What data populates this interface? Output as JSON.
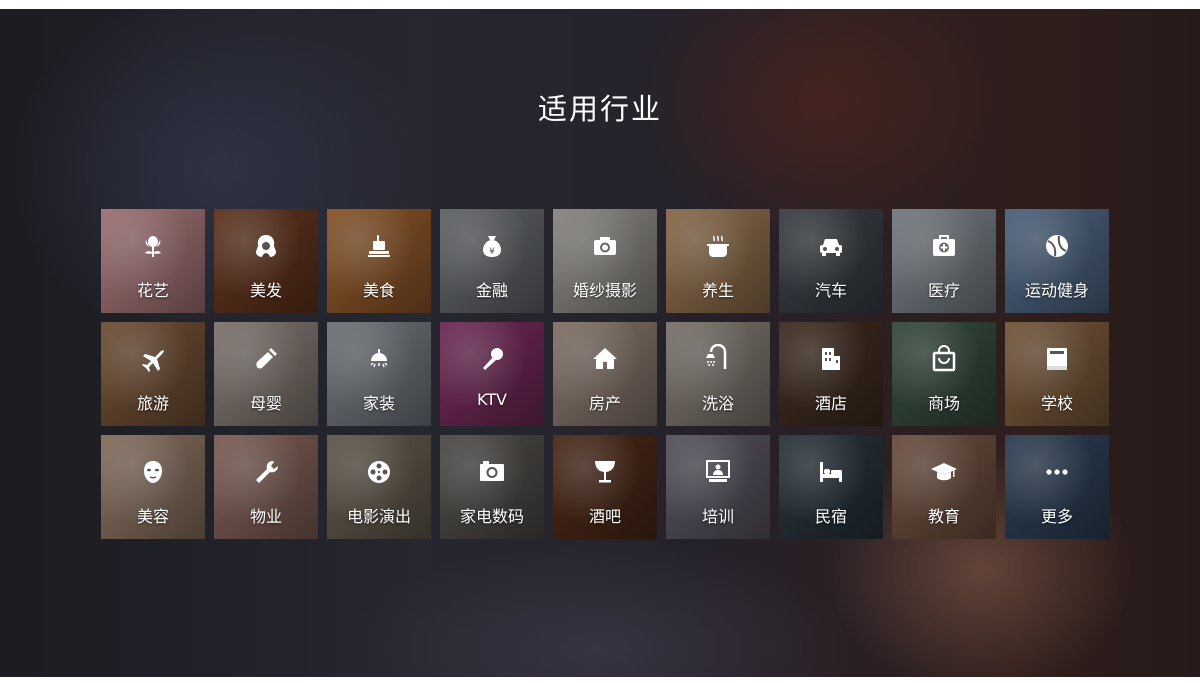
{
  "title": "适用行业",
  "industries": [
    {
      "label": "花艺",
      "icon": "flower-icon",
      "color": "#e7a4a6"
    },
    {
      "label": "美发",
      "icon": "hair-icon",
      "color": "#8a4a2b"
    },
    {
      "label": "美食",
      "icon": "food-icon",
      "color": "#c87a3a"
    },
    {
      "label": "金融",
      "icon": "money-bag-icon",
      "color": "#8a8f95"
    },
    {
      "label": "婚纱摄影",
      "icon": "camera-icon",
      "color": "#c7c2ba"
    },
    {
      "label": "养生",
      "icon": "pot-icon",
      "color": "#c89a6a"
    },
    {
      "label": "汽车",
      "icon": "car-icon",
      "color": "#525963"
    },
    {
      "label": "医疗",
      "icon": "medical-kit-icon",
      "color": "#a8b2bc"
    },
    {
      "label": "运动健身",
      "icon": "ball-icon",
      "color": "#6d8db5"
    },
    {
      "label": "旅游",
      "icon": "airplane-icon",
      "color": "#a0704a"
    },
    {
      "label": "母婴",
      "icon": "baby-bottle-icon",
      "color": "#b7a9a0"
    },
    {
      "label": "家装",
      "icon": "lamp-icon",
      "color": "#9fa7b0"
    },
    {
      "label": "KTV",
      "icon": "microphone-icon",
      "color": "#a23b7c"
    },
    {
      "label": "房产",
      "icon": "house-icon",
      "color": "#bba596"
    },
    {
      "label": "洗浴",
      "icon": "shower-icon",
      "color": "#b2a69c"
    },
    {
      "label": "酒店",
      "icon": "hotel-icon",
      "color": "#5a3f2e"
    },
    {
      "label": "商场",
      "icon": "shopping-bag-icon",
      "color": "#4b6a58"
    },
    {
      "label": "学校",
      "icon": "book-icon",
      "color": "#a97c52"
    },
    {
      "label": "美容",
      "icon": "mask-icon",
      "color": "#c2a088"
    },
    {
      "label": "物业",
      "icon": "wrench-icon",
      "color": "#b5867a"
    },
    {
      "label": "电影演出",
      "icon": "film-reel-icon",
      "color": "#8a7e6c"
    },
    {
      "label": "家电数码",
      "icon": "photo-camera-icon",
      "color": "#6f6a66"
    },
    {
      "label": "酒吧",
      "icon": "cocktail-icon",
      "color": "#6a3a22"
    },
    {
      "label": "培训",
      "icon": "presentation-icon",
      "color": "#7d7688"
    },
    {
      "label": "民宿",
      "icon": "bed-icon",
      "color": "#3a4a55"
    },
    {
      "label": "教育",
      "icon": "graduation-cap-icon",
      "color": "#9b6f58"
    },
    {
      "label": "更多",
      "icon": "more-icon",
      "color": "#3f5a7a"
    }
  ]
}
